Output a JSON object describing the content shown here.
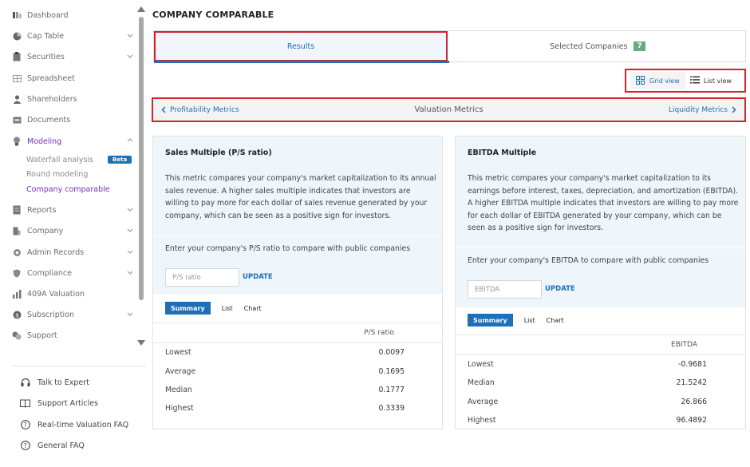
{
  "sidebar": {
    "items": [
      {
        "label": "Dashboard",
        "icon": "dashboard-icon"
      },
      {
        "label": "Cap Table",
        "icon": "pie-chart-icon"
      },
      {
        "label": "Securities",
        "icon": "clipboard-icon"
      },
      {
        "label": "Spreadsheet",
        "icon": "spreadsheet-icon"
      },
      {
        "label": "Shareholders",
        "icon": "person-icon"
      },
      {
        "label": "Documents",
        "icon": "folder-icon"
      },
      {
        "label": "Modeling",
        "icon": "lightbulb-icon"
      },
      {
        "label": "Reports",
        "icon": "report-icon"
      },
      {
        "label": "Company",
        "icon": "building-icon"
      },
      {
        "label": "Admin Records",
        "icon": "gear-icon"
      },
      {
        "label": "Compliance",
        "icon": "shield-icon"
      },
      {
        "label": "409A Valuation",
        "icon": "chart-icon"
      },
      {
        "label": "Subscription",
        "icon": "coin-icon"
      },
      {
        "label": "Support",
        "icon": "support-icon"
      }
    ],
    "modeling_sub": [
      {
        "label": "Waterfall analysis",
        "badge": "Beta"
      },
      {
        "label": "Round modeling"
      },
      {
        "label": "Company comparable"
      }
    ],
    "footer": [
      {
        "label": "Talk to Expert",
        "icon": "headphones-icon"
      },
      {
        "label": "Support Articles",
        "icon": "book-icon"
      },
      {
        "label": "Real-time Valuation FAQ",
        "icon": "question-icon"
      },
      {
        "label": "General FAQ",
        "icon": "question-icon"
      }
    ]
  },
  "page": {
    "title": "COMPANY COMPARABLE",
    "tabs": [
      {
        "label": "Results"
      },
      {
        "label": "Selected Companies",
        "count": "7"
      }
    ],
    "view_toggle": {
      "grid": "Grid view",
      "list": "List view"
    },
    "metric_nav": {
      "prev": "Profitability Metrics",
      "current": "Valuation Metrics",
      "next": "Liquidity Metrics"
    }
  },
  "cards": [
    {
      "title": "Sales Multiple (P/S ratio)",
      "description": "This metric compares your company's market capitalization to its annual sales revenue. A higher sales multiple indicates that investors are willing to pay more for each dollar of sales revenue generated by your company, which can be seen as a positive sign for investors.",
      "prompt": "Enter your company's P/S ratio to compare with public companies",
      "placeholder": "P/S ratio",
      "update": "UPDATE",
      "subtabs": [
        "Summary",
        "List",
        "Chart"
      ],
      "column": "P/S ratio",
      "rows": [
        {
          "label": "Lowest",
          "value": "0.0097"
        },
        {
          "label": "Average",
          "value": "0.1695"
        },
        {
          "label": "Median",
          "value": "0.1777"
        },
        {
          "label": "Highest",
          "value": "0.3339"
        }
      ]
    },
    {
      "title": "EBITDA Multiple",
      "description": "This metric compares your company's market capitalization to its earnings before interest, taxes, depreciation, and amortization (EBITDA). A higher EBITDA multiple indicates that investors are willing to pay more for each dollar of EBITDA generated by your company, which can be seen as a positive sign for investors.",
      "prompt": "Enter your company's EBITDA to compare with public companies",
      "placeholder": "EBITDA",
      "update": "UPDATE",
      "subtabs": [
        "Summary",
        "List",
        "Chart"
      ],
      "column": "EBITDA",
      "rows": [
        {
          "label": "Lowest",
          "value": "-0.9681"
        },
        {
          "label": "Median",
          "value": "21.5242"
        },
        {
          "label": "Average",
          "value": "26.866"
        },
        {
          "label": "Highest",
          "value": "96.4892"
        }
      ]
    }
  ],
  "colors": {
    "accent": "#1d6fb8",
    "active_nav": "#7b2cbf",
    "highlight_border": "#d0222f",
    "badge": "#6aa882"
  }
}
